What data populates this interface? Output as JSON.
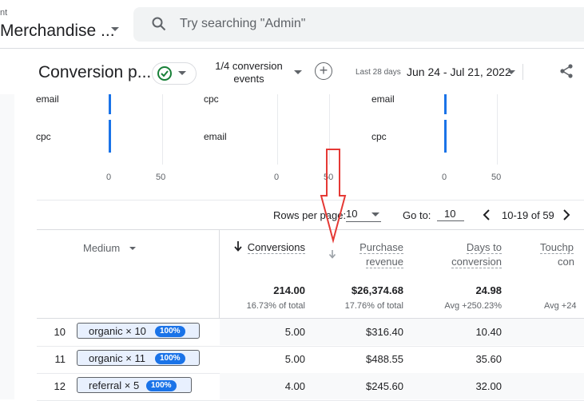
{
  "header": {
    "property_small": "nt",
    "property_name": "Merchandise ...",
    "search_placeholder": "Try searching \"Admin\""
  },
  "report": {
    "title": "Conversion p...",
    "conversion_events_line1": "1/4 conversion",
    "conversion_events_line2": "events",
    "date_preset": "Last 28 days",
    "date_range": "Jun 24 - Jul 21, 2022"
  },
  "chart_data": [
    {
      "type": "bar",
      "categories": [
        "email",
        "cpc"
      ],
      "values": [
        1,
        1
      ],
      "xticks": [
        "0",
        "50"
      ]
    },
    {
      "type": "bar",
      "categories": [
        "cpc",
        "email"
      ],
      "values": [
        0,
        0
      ],
      "xticks": [
        "0",
        "50"
      ]
    },
    {
      "type": "bar",
      "categories": [
        "email",
        "cpc"
      ],
      "values": [
        1,
        1
      ],
      "xticks": [
        "0",
        "50"
      ]
    }
  ],
  "charts_text": {
    "c1": {
      "cat1": "email",
      "cat2": "cpc",
      "t0": "0",
      "t50": "50"
    },
    "c2": {
      "cat1": "cpc",
      "cat2": "email",
      "t0": "0",
      "t50": "50"
    },
    "c3": {
      "cat1": "email",
      "cat2": "cpc",
      "t0": "0",
      "t50": "50"
    }
  },
  "pagination": {
    "rows_label": "Rows per page:",
    "rows_value": "10",
    "goto_label": "Go to:",
    "goto_value": "10",
    "range": "10-19 of 59"
  },
  "table": {
    "col_medium": "Medium",
    "col_conversions": "Conversions",
    "col_revenue_1": "Purchase",
    "col_revenue_2": "revenue",
    "col_days_1": "Days to",
    "col_days_2": "conversion",
    "col_touch_1": "Touchp",
    "col_touch_2": "con",
    "totals": {
      "conversions": "214.00",
      "conversions_sub": "16.73% of total",
      "revenue": "$26,374.68",
      "revenue_sub": "17.76% of total",
      "days": "24.98",
      "days_sub": "Avg +250.23%",
      "touch_sub": "Avg +24"
    },
    "rows": [
      {
        "num": "10",
        "medium": "organic × 10",
        "badge": "100%",
        "conversions": "5.00",
        "revenue": "$316.40",
        "days": "10.40"
      },
      {
        "num": "11",
        "medium": "organic × 11",
        "badge": "100%",
        "conversions": "5.00",
        "revenue": "$488.55",
        "days": "35.60"
      },
      {
        "num": "12",
        "medium": "referral × 5",
        "badge": "100%",
        "conversions": "4.00",
        "revenue": "$245.60",
        "days": "32.00"
      }
    ]
  },
  "colors": {
    "accent": "#1a73e8",
    "annotation_arrow": "#e53935",
    "success": "#188038"
  }
}
